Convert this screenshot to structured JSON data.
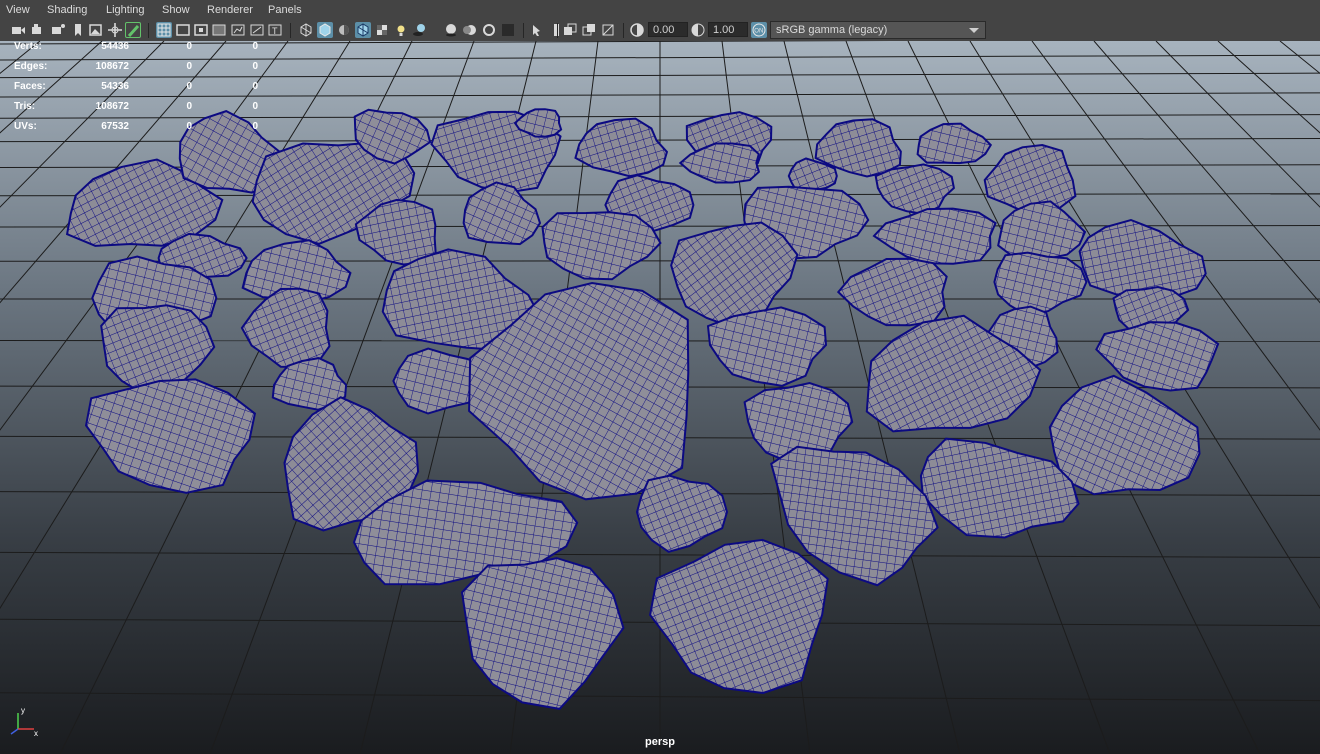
{
  "menu": [
    "View",
    "Shading",
    "Lighting",
    "Show",
    "Renderer",
    "Panels"
  ],
  "toolbar": {
    "exposure_value": "0.00",
    "gamma_value": "1.00",
    "color_space": "sRGB gamma (legacy)"
  },
  "hud": {
    "rows": [
      {
        "label": "Verts:",
        "values": [
          "54436",
          "0",
          "0"
        ]
      },
      {
        "label": "Edges:",
        "values": [
          "108672",
          "0",
          "0"
        ]
      },
      {
        "label": "Faces:",
        "values": [
          "54336",
          "0",
          "0"
        ]
      },
      {
        "label": "Tris:",
        "values": [
          "108672",
          "0",
          "0"
        ]
      },
      {
        "label": "UVs:",
        "values": [
          "67532",
          "0",
          "0"
        ]
      }
    ]
  },
  "camera": "persp",
  "axis_labels": {
    "y": "y",
    "x": "x"
  },
  "colors": {
    "ui_bg": "#444444",
    "viewport_top": "#a7b3be",
    "viewport_bottom": "#1a1c1f",
    "grid": "#1c1c1c",
    "rock_fill": "#8f8e99",
    "wire": "#0c0a82",
    "accent": "#5c8fa8"
  }
}
